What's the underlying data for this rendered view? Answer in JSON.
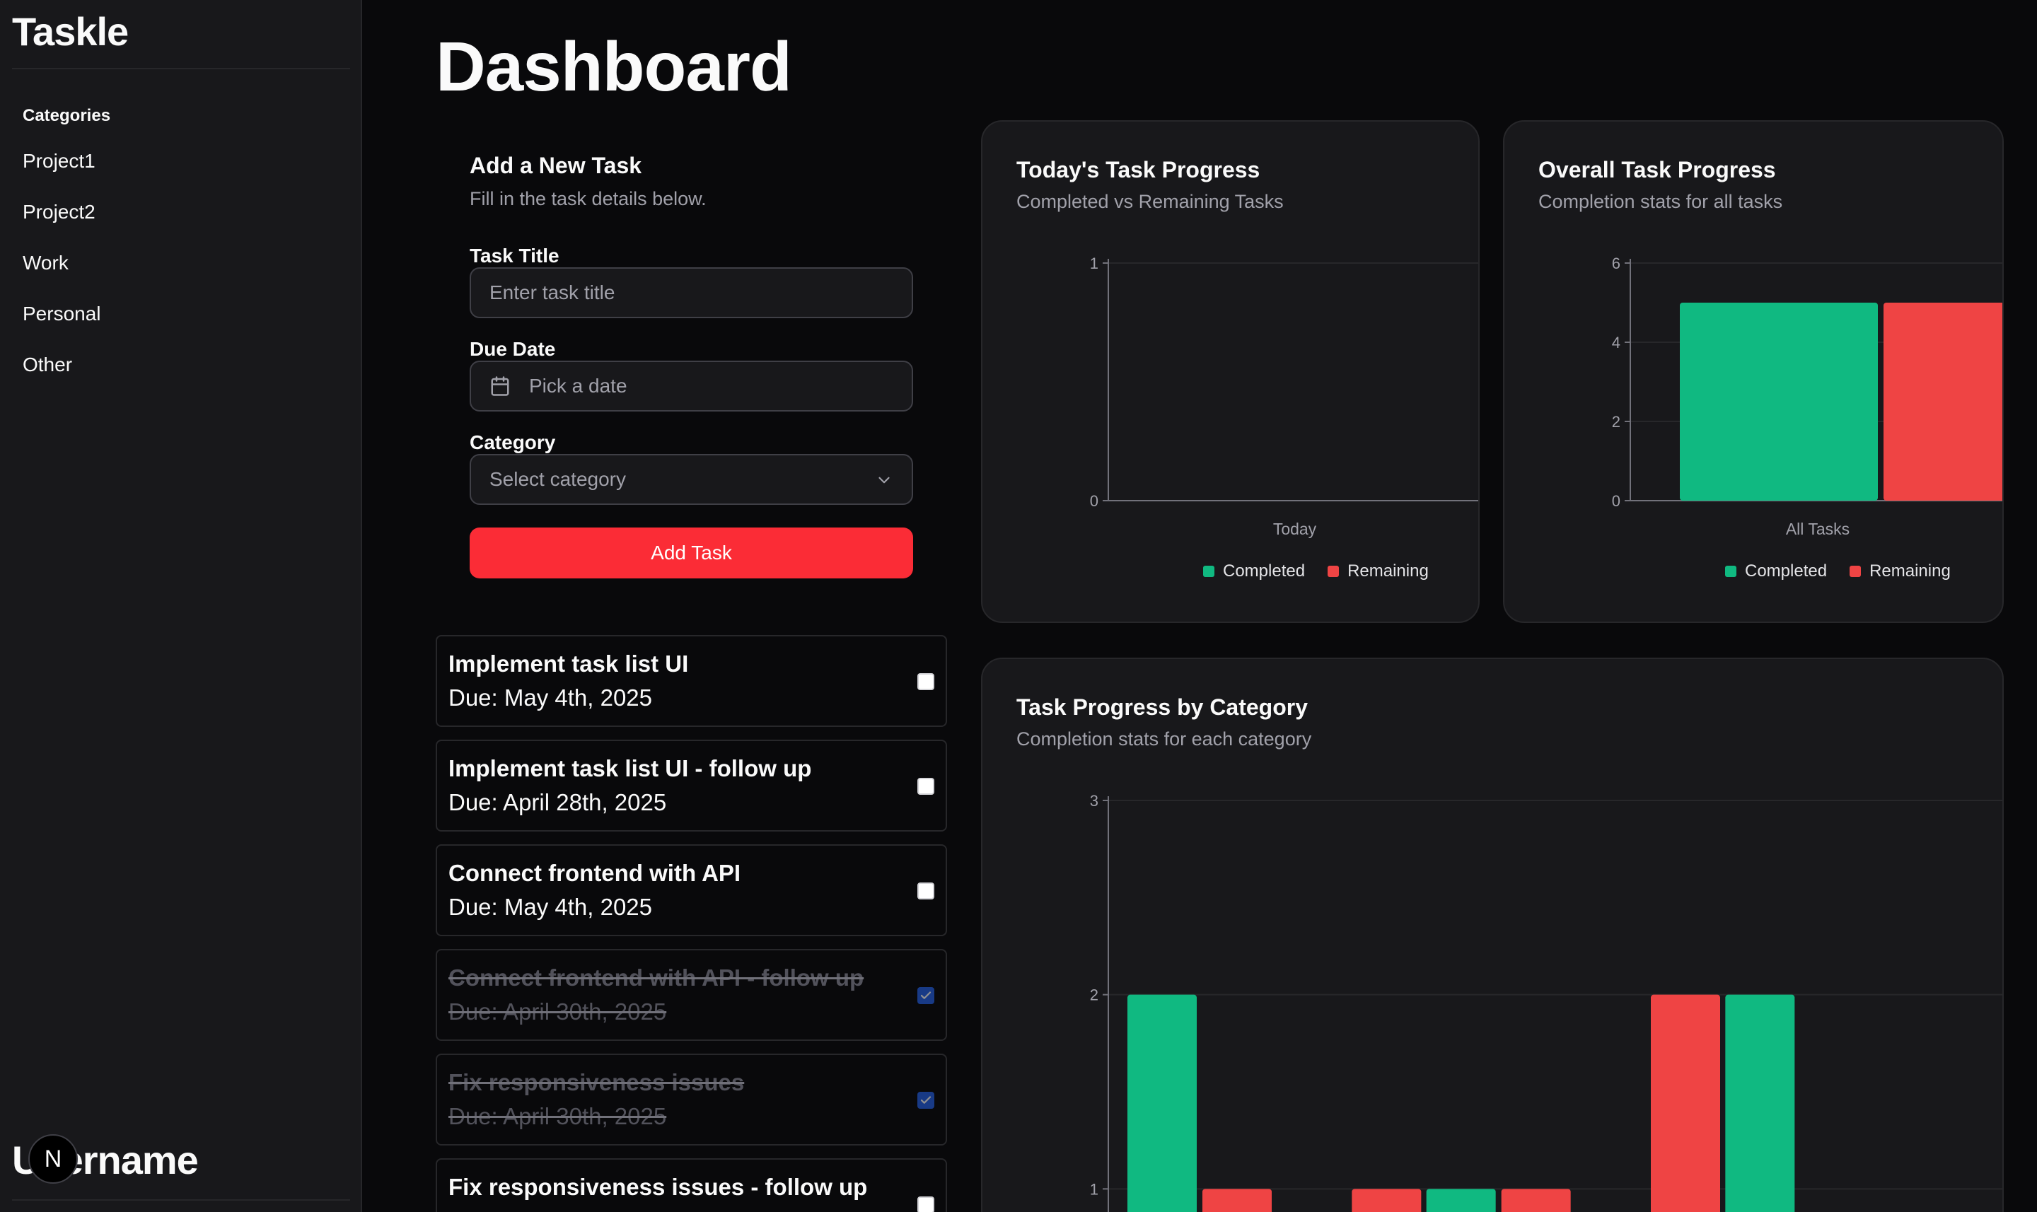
{
  "sidebar": {
    "app_title": "Taskle",
    "categories_label": "Categories",
    "items": [
      {
        "label": "Project1"
      },
      {
        "label": "Project2"
      },
      {
        "label": "Work"
      },
      {
        "label": "Personal"
      },
      {
        "label": "Other"
      }
    ],
    "username": "Username",
    "badge": "N"
  },
  "page": {
    "title": "Dashboard"
  },
  "form": {
    "title": "Add a New Task",
    "subtitle": "Fill in the task details below.",
    "task_title_label": "Task Title",
    "task_title_placeholder": "Enter task title",
    "due_date_label": "Due Date",
    "due_date_placeholder": "Pick a date",
    "category_label": "Category",
    "category_placeholder": "Select category",
    "submit_label": "Add Task"
  },
  "tasks": [
    {
      "title": "Implement task list UI",
      "due": "Due: May 4th, 2025",
      "done": false
    },
    {
      "title": "Implement task list UI - follow up",
      "due": "Due: April 28th, 2025",
      "done": false
    },
    {
      "title": "Connect frontend with API",
      "due": "Due: May 4th, 2025",
      "done": false
    },
    {
      "title": "Connect frontend with API - follow up",
      "due": "Due: April 30th, 2025",
      "done": true
    },
    {
      "title": "Fix responsiveness issues",
      "due": "Due: April 30th, 2025",
      "done": true
    },
    {
      "title": "Fix responsiveness issues - follow up",
      "due": "",
      "done": false
    }
  ],
  "colors": {
    "completed": "#10b981",
    "remaining": "#ef4444",
    "accent": "#fb2c36"
  },
  "cards": {
    "today": {
      "title": "Today's Task Progress",
      "subtitle": "Completed vs Remaining Tasks"
    },
    "overall": {
      "title": "Overall Task Progress",
      "subtitle": "Completion stats for all tasks"
    },
    "category": {
      "title": "Task Progress by Category",
      "subtitle": "Completion stats for each category"
    }
  },
  "legend": {
    "completed": "Completed",
    "remaining": "Remaining"
  },
  "chart_data": [
    {
      "type": "bar",
      "title": "Today's Task Progress",
      "categories": [
        "Today"
      ],
      "series": [
        {
          "name": "Completed",
          "values": [
            0
          ]
        },
        {
          "name": "Remaining",
          "values": [
            0
          ]
        }
      ],
      "yticks": [
        "0",
        "1"
      ],
      "ylim": [
        0,
        1
      ],
      "grid": true,
      "legend": "bottom"
    },
    {
      "type": "bar",
      "title": "Overall Task Progress",
      "categories": [
        "All Tasks"
      ],
      "series": [
        {
          "name": "Completed",
          "values": [
            5
          ]
        },
        {
          "name": "Remaining",
          "values": [
            5
          ]
        }
      ],
      "yticks": [
        "0",
        "2",
        "4",
        "6"
      ],
      "ylim": [
        0,
        6
      ],
      "grid": true,
      "legend": "bottom"
    },
    {
      "type": "bar",
      "title": "Task Progress by Category",
      "groups": 6,
      "series": [
        {
          "name": "Completed",
          "values": [
            2,
            0,
            1,
            0,
            2,
            0
          ]
        },
        {
          "name": "Remaining",
          "values": [
            1,
            1,
            1,
            2,
            0,
            0
          ]
        }
      ],
      "yticks": [
        "1",
        "2",
        "3"
      ],
      "ylim": [
        0,
        3
      ],
      "grid": true
    }
  ]
}
